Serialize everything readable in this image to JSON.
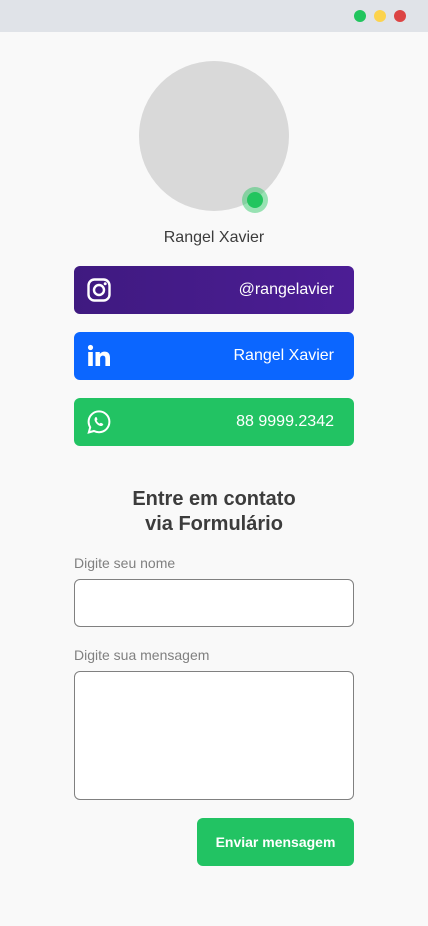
{
  "window": {
    "controls": [
      {
        "name": "green-dot",
        "color": "#22c55e"
      },
      {
        "name": "yellow-dot",
        "color": "#fcd34d"
      },
      {
        "name": "red-dot",
        "color": "#dc4444"
      }
    ]
  },
  "profile": {
    "name": "Rangel Xavier",
    "avatar_color": "#d9d9d9",
    "status_color": "#22c55e"
  },
  "social": {
    "instagram": {
      "label": "@rangelavier",
      "icon": "instagram-icon"
    },
    "linkedin": {
      "label": "Rangel Xavier",
      "icon": "linkedin-icon",
      "color": "#0b66ff"
    },
    "whatsapp": {
      "label": "88 9999.2342",
      "icon": "whatsapp-icon",
      "color": "#22c363"
    }
  },
  "form": {
    "title_line1": "Entre em contato",
    "title_line2": "via Formulário",
    "name_label": "Digite seu nome",
    "name_value": "",
    "message_label": "Digite sua mensagem",
    "message_value": "",
    "submit_label": "Enviar mensagem",
    "submit_color": "#22c363"
  }
}
